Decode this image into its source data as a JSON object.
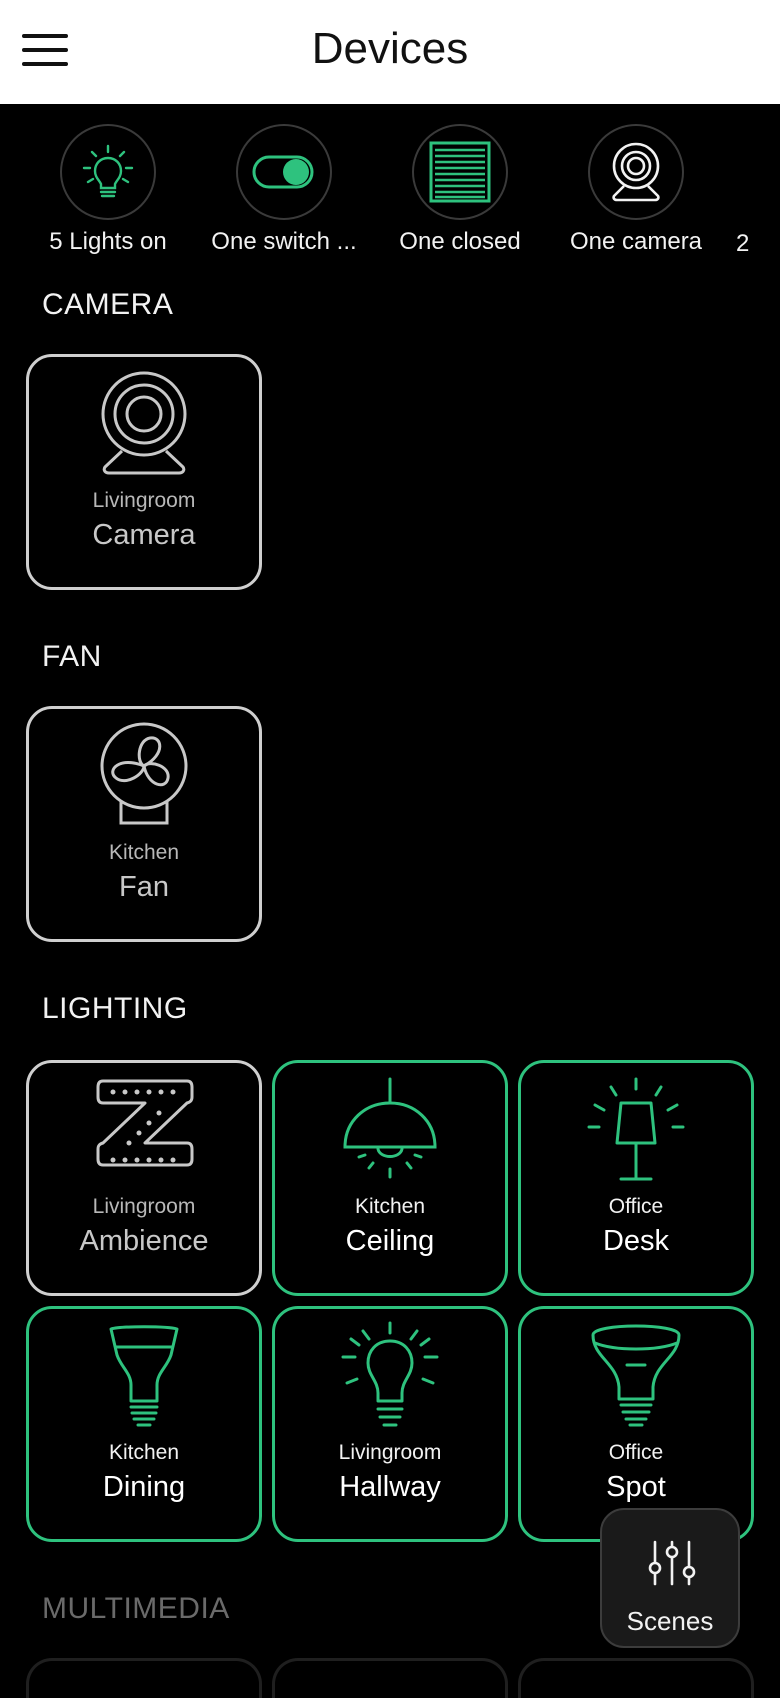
{
  "header": {
    "title": "Devices"
  },
  "summary": [
    {
      "label": "5 Lights on",
      "icon": "light-bulb-icon"
    },
    {
      "label": "One switch ...",
      "icon": "toggle-switch-icon"
    },
    {
      "label": "One closed",
      "icon": "blinds-icon"
    },
    {
      "label": "One camera",
      "icon": "camera-icon"
    }
  ],
  "summary_extra": "2",
  "sections": {
    "camera": {
      "title": "CAMERA",
      "tiles": [
        {
          "room": "Livingroom",
          "name": "Camera",
          "state": "off",
          "icon": "camera-icon"
        }
      ]
    },
    "fan": {
      "title": "FAN",
      "tiles": [
        {
          "room": "Kitchen",
          "name": "Fan",
          "state": "off",
          "icon": "fan-icon"
        }
      ]
    },
    "lighting": {
      "title": "LIGHTING",
      "tiles": [
        {
          "room": "Livingroom",
          "name": "Ambience",
          "state": "off",
          "icon": "light-strip-icon"
        },
        {
          "room": "Kitchen",
          "name": "Ceiling",
          "state": "on",
          "icon": "ceiling-lamp-icon"
        },
        {
          "room": "Office",
          "name": "Desk",
          "state": "on",
          "icon": "desk-lamp-icon"
        },
        {
          "room": "Kitchen",
          "name": "Dining",
          "state": "on",
          "icon": "flood-bulb-icon"
        },
        {
          "room": "Livingroom",
          "name": "Hallway",
          "state": "on",
          "icon": "light-bulb-icon"
        },
        {
          "room": "Office",
          "name": "Spot",
          "state": "on",
          "icon": "spot-bulb-icon"
        }
      ]
    },
    "multimedia": {
      "title": "MULTIMEDIA"
    }
  },
  "scenes_button": {
    "label": "Scenes",
    "icon": "sliders-icon"
  },
  "colors": {
    "accent": "#2ec27e",
    "off_border": "#cfcfcf",
    "background": "#000000",
    "header_bg": "#ffffff"
  }
}
